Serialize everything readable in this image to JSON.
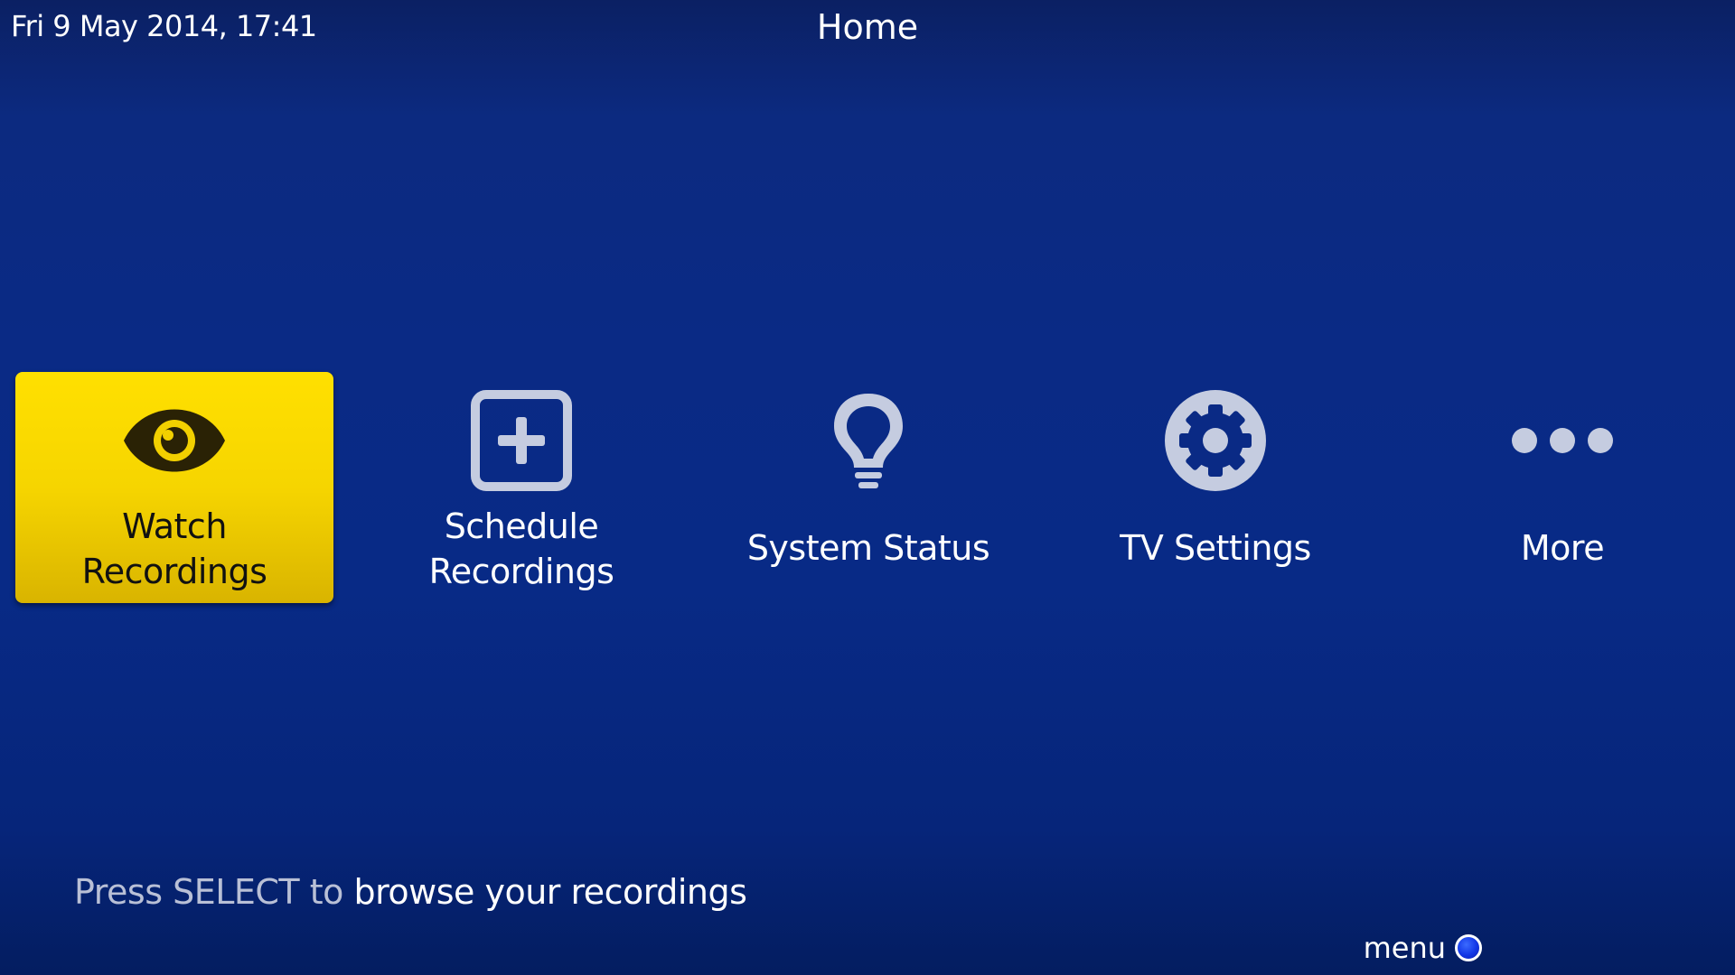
{
  "header": {
    "datetime": "Fri 9 May 2014, 17:41",
    "title": "Home"
  },
  "menu": {
    "items": [
      {
        "label_line1": "Watch",
        "label_line2": "Recordings",
        "icon": "eye-icon",
        "selected": true
      },
      {
        "label_line1": "Schedule",
        "label_line2": "Recordings",
        "icon": "plus-square-icon",
        "selected": false
      },
      {
        "label": "System Status",
        "icon": "lightbulb-icon",
        "selected": false
      },
      {
        "label": "TV Settings",
        "icon": "gear-icon",
        "selected": false
      },
      {
        "label": "More",
        "icon": "more-dots-icon",
        "selected": false
      }
    ]
  },
  "hint": {
    "key_text": "Press SELECT to",
    "action_text": "browse your recordings"
  },
  "legend": {
    "menu_label": "menu",
    "menu_button_color": "#1236e6"
  },
  "colors": {
    "background": "#0a2a85",
    "selected_tile": "#f6d500",
    "icon_fill": "#c5cce0"
  }
}
